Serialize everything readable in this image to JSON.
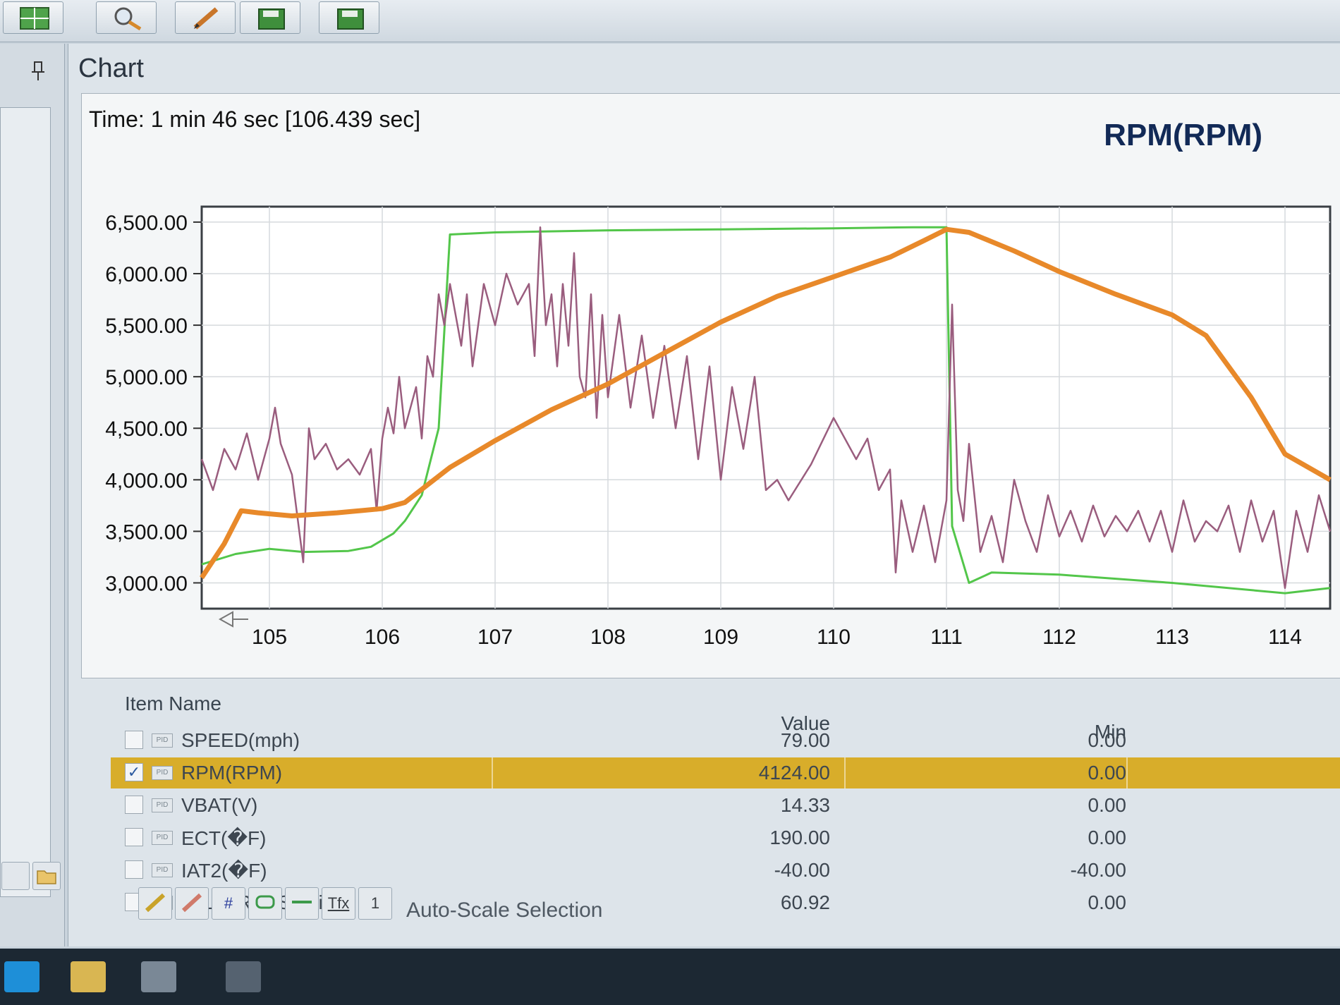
{
  "panel": {
    "title": "Chart"
  },
  "chart_header": {
    "time_label": "Time: 1 min 46 sec [106.439 sec]",
    "series_title": "RPM(RPM)"
  },
  "colors": {
    "rpm": "#e8892a",
    "speed": "#53c64a",
    "throttle": "#9a5d7e",
    "selected_row": "#d8ad2a",
    "title": "#122a57"
  },
  "chart_data": {
    "type": "line",
    "xlim": [
      104.4,
      114.4
    ],
    "ylim": [
      2750,
      6650
    ],
    "x_ticks": [
      105,
      106,
      107,
      108,
      109,
      110,
      111,
      112,
      113,
      114
    ],
    "y_ticks": [
      3000,
      3500,
      4000,
      4500,
      5000,
      5500,
      6000,
      6500
    ],
    "y_tick_labels": [
      "3,000.00",
      "3,500.00",
      "4,000.00",
      "4,500.00",
      "5,000.00",
      "5,500.00",
      "6,000.00",
      "6,500.00"
    ],
    "grid": true,
    "series": [
      {
        "key": "rpm",
        "x": [
          104.4,
          104.6,
          104.75,
          104.9,
          105.2,
          105.6,
          106.0,
          106.2,
          106.4,
          106.6,
          107.0,
          107.5,
          108.0,
          108.5,
          109.0,
          109.5,
          110.0,
          110.5,
          110.8,
          111.0,
          111.2,
          111.6,
          112.0,
          112.5,
          113.0,
          113.3,
          113.7,
          114.0,
          114.4
        ],
        "y": [
          3050,
          3380,
          3700,
          3680,
          3650,
          3680,
          3720,
          3780,
          3950,
          4120,
          4380,
          4680,
          4930,
          5230,
          5530,
          5780,
          5970,
          6160,
          6320,
          6430,
          6400,
          6220,
          6020,
          5800,
          5600,
          5400,
          4800,
          4250,
          4000
        ]
      },
      {
        "key": "speed",
        "x": [
          104.4,
          104.7,
          105.0,
          105.3,
          105.7,
          105.9,
          106.1,
          106.2,
          106.35,
          106.5,
          106.6,
          107.0,
          108.0,
          109.0,
          110.0,
          110.7,
          111.0,
          111.05,
          111.2,
          111.4,
          112.0,
          113.0,
          114.0,
          114.4
        ],
        "y": [
          3180,
          3280,
          3330,
          3300,
          3310,
          3350,
          3480,
          3600,
          3850,
          4500,
          6380,
          6400,
          6420,
          6430,
          6440,
          6450,
          6450,
          3550,
          3000,
          3100,
          3080,
          3000,
          2900,
          2950
        ]
      },
      {
        "key": "throttle",
        "x": [
          104.4,
          104.5,
          104.6,
          104.7,
          104.8,
          104.9,
          105.0,
          105.05,
          105.1,
          105.2,
          105.3,
          105.35,
          105.4,
          105.5,
          105.6,
          105.7,
          105.8,
          105.9,
          105.95,
          106.0,
          106.05,
          106.1,
          106.15,
          106.2,
          106.3,
          106.35,
          106.4,
          106.45,
          106.5,
          106.55,
          106.6,
          106.7,
          106.75,
          106.8,
          106.9,
          107.0,
          107.1,
          107.2,
          107.3,
          107.35,
          107.4,
          107.45,
          107.5,
          107.55,
          107.6,
          107.65,
          107.7,
          107.75,
          107.8,
          107.85,
          107.9,
          107.95,
          108.0,
          108.1,
          108.2,
          108.3,
          108.4,
          108.5,
          108.6,
          108.7,
          108.8,
          108.9,
          109.0,
          109.1,
          109.2,
          109.3,
          109.4,
          109.5,
          109.6,
          109.8,
          110.0,
          110.2,
          110.3,
          110.4,
          110.5,
          110.55,
          110.6,
          110.7,
          110.8,
          110.9,
          111.0,
          111.05,
          111.1,
          111.15,
          111.2,
          111.3,
          111.4,
          111.5,
          111.6,
          111.7,
          111.8,
          111.9,
          112.0,
          112.1,
          112.2,
          112.3,
          112.4,
          112.5,
          112.6,
          112.7,
          112.8,
          112.9,
          113.0,
          113.1,
          113.2,
          113.3,
          113.4,
          113.5,
          113.6,
          113.7,
          113.8,
          113.9,
          114.0,
          114.1,
          114.2,
          114.3,
          114.4
        ],
        "y": [
          4200,
          3900,
          4300,
          4100,
          4450,
          4000,
          4400,
          4700,
          4350,
          4050,
          3200,
          4500,
          4200,
          4350,
          4100,
          4200,
          4050,
          4300,
          3700,
          4400,
          4700,
          4450,
          5000,
          4500,
          4900,
          4400,
          5200,
          5000,
          5800,
          5500,
          5900,
          5300,
          5800,
          5100,
          5900,
          5500,
          6000,
          5700,
          5900,
          5200,
          6450,
          5500,
          5800,
          5100,
          5900,
          5300,
          6200,
          5000,
          4800,
          5800,
          4600,
          5600,
          4800,
          5600,
          4700,
          5400,
          4600,
          5300,
          4500,
          5200,
          4200,
          5100,
          4000,
          4900,
          4300,
          5000,
          3900,
          4000,
          3800,
          4150,
          4600,
          4200,
          4400,
          3900,
          4100,
          3100,
          3800,
          3300,
          3750,
          3200,
          3800,
          5700,
          3900,
          3600,
          4350,
          3300,
          3650,
          3200,
          4000,
          3600,
          3300,
          3850,
          3450,
          3700,
          3400,
          3750,
          3450,
          3650,
          3500,
          3700,
          3400,
          3700,
          3300,
          3800,
          3400,
          3600,
          3500,
          3750,
          3300,
          3800,
          3400,
          3700,
          2950,
          3700,
          3300,
          3850,
          3500
        ]
      }
    ]
  },
  "grid_table": {
    "headers": {
      "item_name": "Item Name",
      "value": "Value",
      "min": "Min"
    },
    "rows": [
      {
        "name": "SPEED(mph)",
        "value": "79.00",
        "min": "0.00",
        "checked": false
      },
      {
        "name": "RPM(RPM)",
        "value": "4124.00",
        "min": "0.00",
        "checked": true
      },
      {
        "name": "VBAT(V)",
        "value": "14.33",
        "min": "0.00",
        "checked": false
      },
      {
        "name": "ECT(�F)",
        "value": "190.00",
        "min": "0.00",
        "checked": false
      },
      {
        "name": "IAT2(�F)",
        "value": "-40.00",
        "min": "-40.00",
        "checked": false
      },
      {
        "name": "OIL_PRESS(psi)",
        "value": "60.92",
        "min": "0.00",
        "checked": false
      }
    ],
    "checkmark": "✓",
    "pid_badge": "PID"
  },
  "bottom_tools": {
    "hash_label": "#",
    "text_label": "Tfx",
    "one_label": "1",
    "autoscale_label": "Auto-Scale Selection"
  },
  "icons": [
    "grid-icon",
    "magnifier-icon",
    "pencil-icon",
    "save-icon",
    "pin-icon",
    "refresh-icon",
    "folder-icon",
    "arrow-left-icon"
  ]
}
